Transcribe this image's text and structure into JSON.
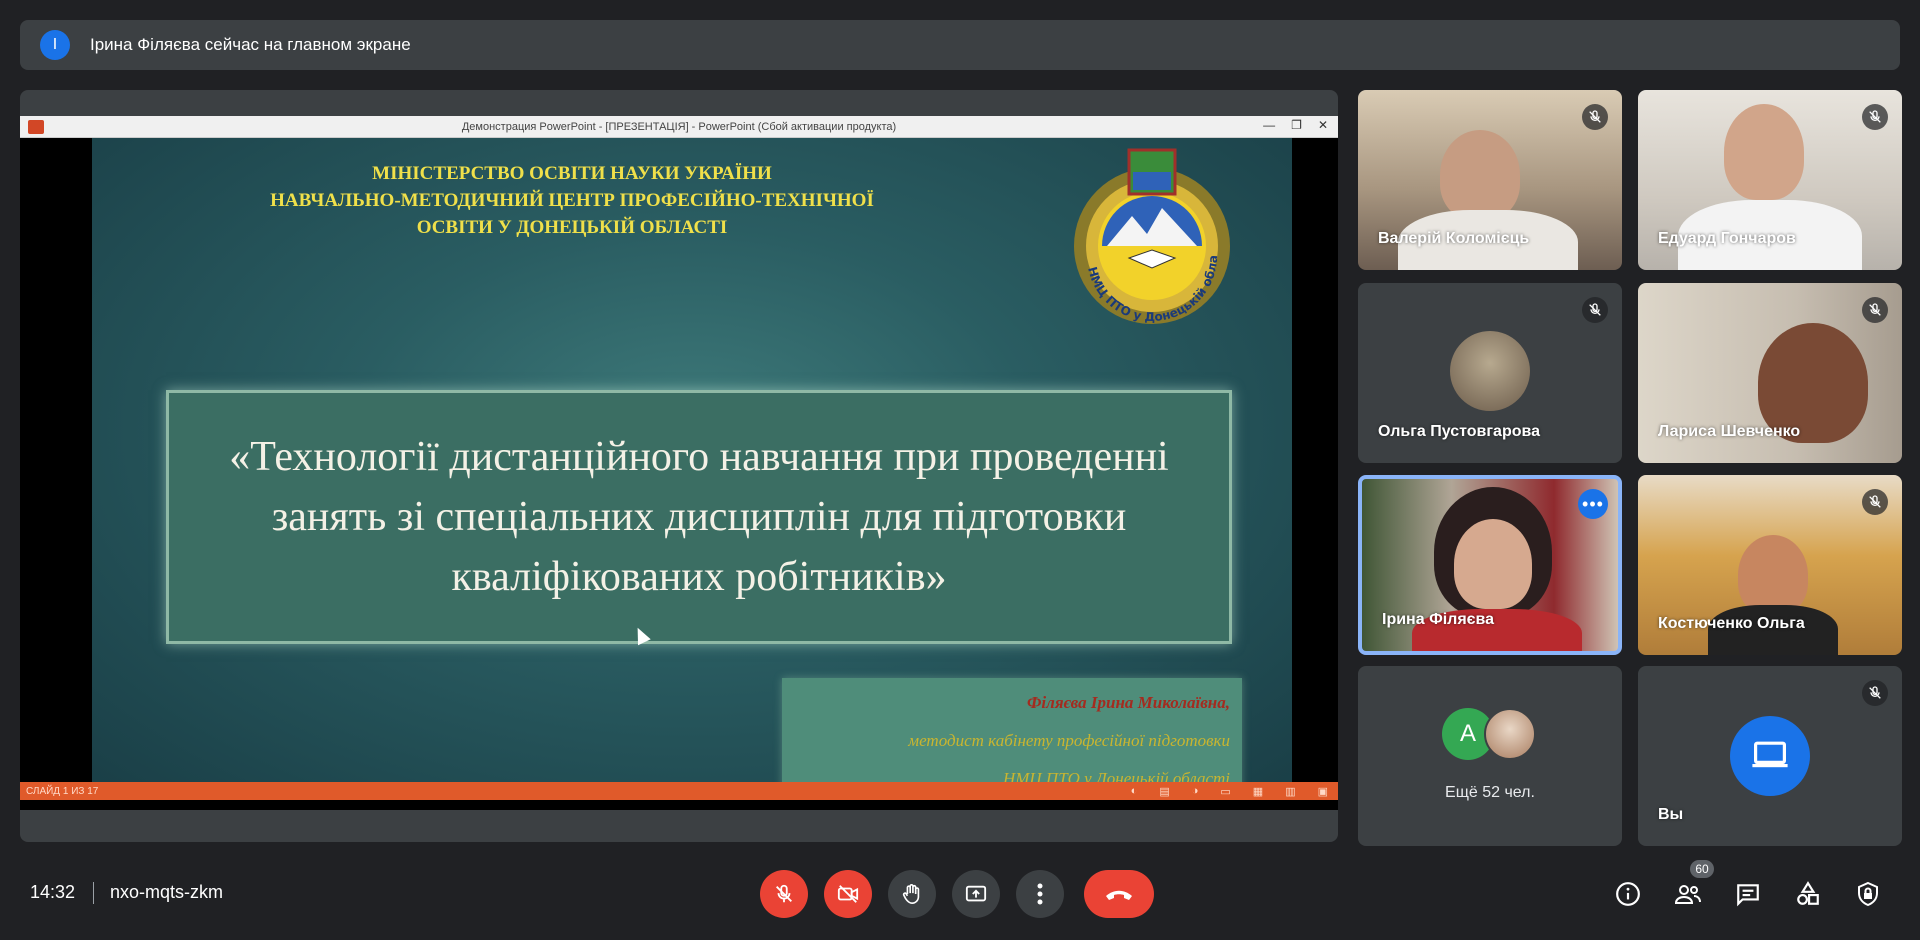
{
  "banner": {
    "initial": "І",
    "text": "Ірина Філяєва сейчас на главном экране"
  },
  "presentation": {
    "window_title": "Демонстрация PowerPoint - [ПРЕЗЕНТАЦІЯ] - PowerPoint (Сбой активации продукта)",
    "window_controls": [
      "—",
      "❐",
      "✕"
    ],
    "ministry_lines": [
      "МІНІСТЕРСТВО ОСВІТИ НАУКИ УКРАЇНИ",
      "НАВЧАЛЬНО-МЕТОДИЧНИЙ ЦЕНТР  ПРОФЕСІЙНО-ТЕХНІЧНОЇ",
      "ОСВІТИ У ДОНЕЦЬКІЙ ОБЛАСТІ"
    ],
    "crest_text": "НМЦ ПТО у Донецькій області",
    "title": "«Технології дистанційного навчання при проведенні занять зі спеціальних дисциплін для підготовки кваліфікованих робітників»",
    "author_name": "Філяєва Ірина Миколаївна,",
    "author_role": "методист кабінету професійної підготовки",
    "author_org": "НМЦ ПТО у Донецькій області",
    "status_text": "СЛАЙД 1 ИЗ 17"
  },
  "participants": [
    {
      "name": "Валерій Коломієць",
      "muted": true
    },
    {
      "name": "Едуард Гончаров",
      "muted": true
    },
    {
      "name": "Ольга Пустовгарова",
      "muted": true
    },
    {
      "name": "Лариса Шевченко",
      "muted": true
    },
    {
      "name": "Ірина Філяєва",
      "muted": false,
      "active": true
    },
    {
      "name": "Костюченко Ольга",
      "muted": true
    }
  ],
  "others": {
    "initial": "A",
    "label": "Ещё 52 чел."
  },
  "self": {
    "name": "Вы",
    "muted": true
  },
  "bottom_bar": {
    "time": "14:32",
    "meeting_code": "nxo-mqts-zkm",
    "participant_count": "60"
  },
  "colors": {
    "accent": "#1a73e8",
    "danger": "#ea4335",
    "surface": "#3c4043",
    "background": "#202124"
  },
  "icons": [
    "mic-off-icon",
    "camera-off-icon",
    "raise-hand-icon",
    "present-icon",
    "more-vert-icon",
    "hangup-icon",
    "info-icon",
    "people-icon",
    "chat-icon",
    "activities-icon",
    "host-controls-icon"
  ]
}
